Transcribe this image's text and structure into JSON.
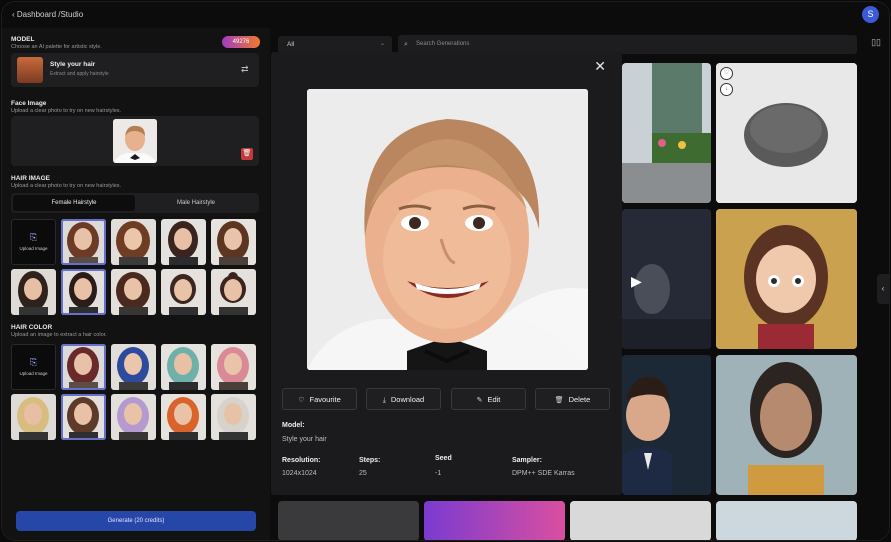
{
  "header": {
    "breadcrumb": "Dashboard /Studio",
    "avatar_initial": "S"
  },
  "sidebar": {
    "model": {
      "title": "MODEL",
      "subtitle": "Choose an AI palette for artistic style.",
      "credits": "49276",
      "card_name": "Style your hair",
      "card_desc": "Extract and apply hairstyle"
    },
    "face": {
      "title": "Face Image",
      "subtitle": "Upload a clear photo to try on new hairstyles."
    },
    "hair_image": {
      "title": "HAIR IMAGE",
      "subtitle": "Upload a clear photo to try on new hairstyles.",
      "tabs": [
        "Female Hairstyle",
        "Male Hairstyle"
      ],
      "upload_label": "Upload Image"
    },
    "hair_color": {
      "title": "HAIR COLOR",
      "subtitle": "Upload an image to extract a hair color.",
      "upload_label": "Upload Image"
    },
    "generate_label": "Generate (20 credits)"
  },
  "main": {
    "filter_value": "All",
    "search_placeholder": "Search Generations"
  },
  "modal": {
    "actions": {
      "favourite": "Favourite",
      "download": "Download",
      "edit": "Edit",
      "delete": "Delete"
    },
    "model_label": "Model:",
    "model_value": "Style your hair",
    "resolution_label": "Resolution:",
    "resolution_value": "1024x1024",
    "steps_label": "Steps:",
    "steps_value": "25",
    "seed_label": "Seed",
    "seed_value": "-1",
    "sampler_label": "Sampler:",
    "sampler_value": "DPM++ SDE Karras"
  },
  "colors": {
    "accent": "#2747a8",
    "selection": "#6670c8",
    "danger": "#c23a3a"
  }
}
